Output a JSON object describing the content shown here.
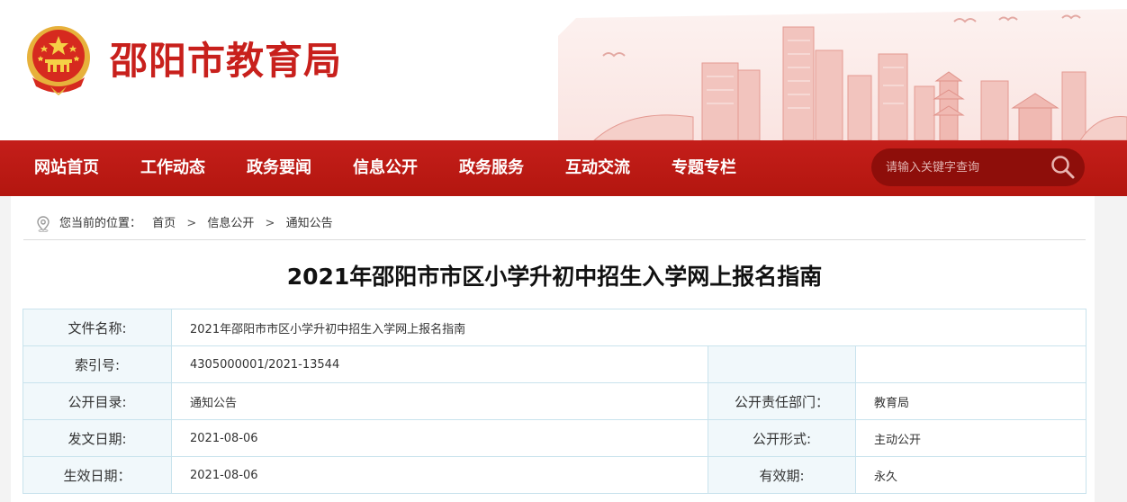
{
  "header": {
    "site_title": "邵阳市教育局"
  },
  "nav": {
    "items": [
      {
        "label": "网站首页"
      },
      {
        "label": "工作动态"
      },
      {
        "label": "政务要闻"
      },
      {
        "label": "信息公开"
      },
      {
        "label": "政务服务"
      },
      {
        "label": "互动交流"
      },
      {
        "label": "专题专栏"
      }
    ],
    "search_placeholder": "请输入关键字查询"
  },
  "breadcrumb": {
    "prefix": "您当前的位置：",
    "items": [
      "首页",
      "信息公开",
      "通知公告"
    ],
    "separator": ">"
  },
  "article": {
    "title": "2021年邵阳市市区小学升初中招生入学网上报名指南"
  },
  "info": {
    "file_name_label": "文件名称:",
    "file_name": "2021年邵阳市市区小学升初中招生入学网上报名指南",
    "index_label": "索引号:",
    "index": "4305000001/2021-13544",
    "catalog_label": "公开目录:",
    "catalog": "通知公告",
    "dept_label": "公开责任部门：",
    "dept": "教育局",
    "issue_date_label": "发文日期:",
    "issue_date": "2021-08-06",
    "form_label": "公开形式:",
    "form": "主动公开",
    "effective_date_label": "生效日期：",
    "effective_date": "2021-08-06",
    "validity_label": "有效期:",
    "validity": "永久"
  },
  "colors": {
    "brand_red": "#c41e1a",
    "title_red": "#c8201c",
    "table_label_bg": "#f1f8fb",
    "table_border": "#c9e3ed"
  },
  "icons": {
    "emblem": "national-emblem-icon",
    "search": "search-icon",
    "location": "location-pin-icon"
  }
}
